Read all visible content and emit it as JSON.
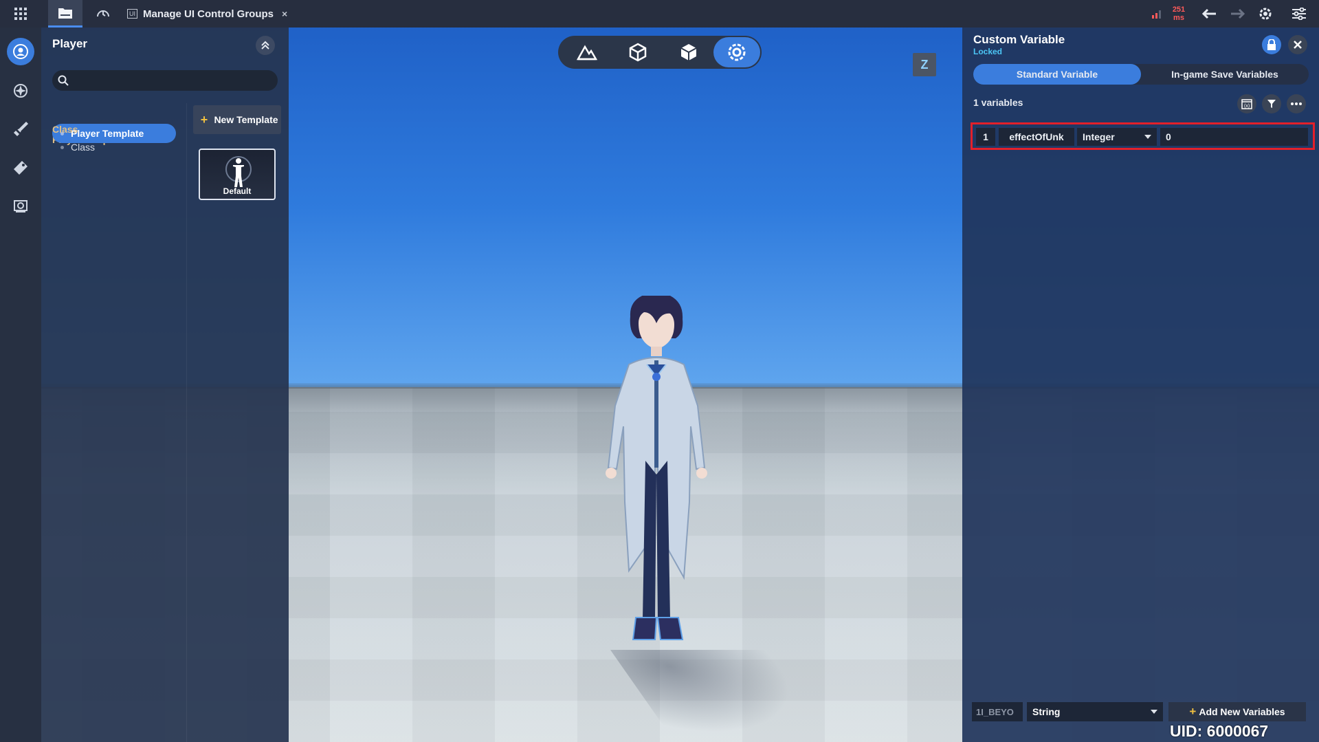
{
  "topbar": {
    "tab_badge": "UI",
    "tab_title": "Manage UI Control Groups",
    "tab_close": "×",
    "ping_value": "251",
    "ping_unit": "ms"
  },
  "player_panel": {
    "title": "Player",
    "search_placeholder": "",
    "tree": {
      "player_template_header": "Player Template",
      "player_template_item": "Player Template",
      "class_header": "Class",
      "class_item": "Class"
    },
    "new_template_label": "New Template",
    "default_template_label": "Default"
  },
  "viewport": {
    "z_label": "Z"
  },
  "custom_variable": {
    "title": "Custom Variable",
    "status": "Locked",
    "tabs": [
      "Standard Variable",
      "In-game Save Variables"
    ],
    "count_text": "1 variables",
    "rows": [
      {
        "index": "1",
        "name": "effectOfUnk",
        "type": "Integer",
        "value": "0"
      }
    ],
    "new_var_name": "1I_BEYO",
    "new_var_type": "String",
    "add_button": "Add New Variables"
  },
  "uid_text": "UID: 6000067",
  "colors": {
    "accent": "#3b7ddd",
    "locked": "#4cc6f5",
    "highlight": "#e3202a",
    "ping": "#ff5a5a"
  }
}
